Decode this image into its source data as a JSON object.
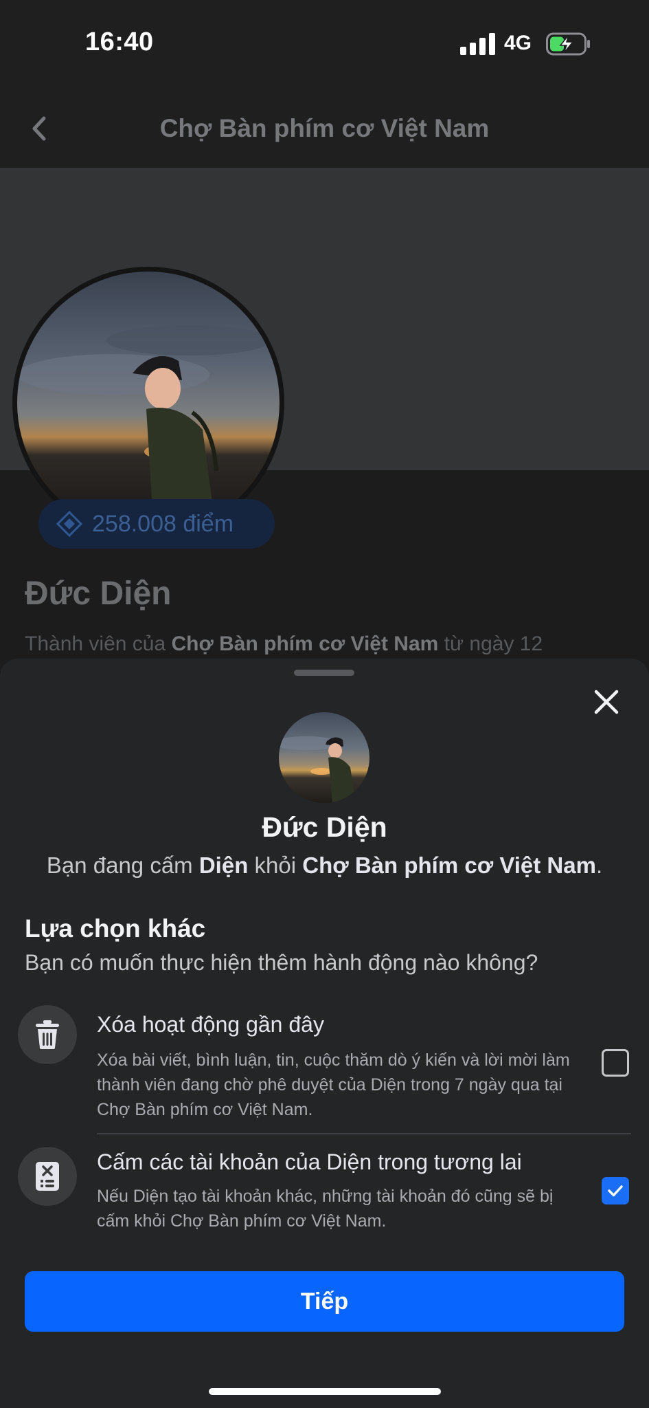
{
  "status_bar": {
    "time": "16:40",
    "network": "4G"
  },
  "header": {
    "title": "Chợ Bàn phím cơ Việt Nam"
  },
  "profile": {
    "points": "258.008 điểm",
    "name": "Đức Diện",
    "member_prefix": "Thành viên của ",
    "member_group": "Chợ Bàn phím cơ Việt Nam",
    "member_suffix": " từ ngày 12"
  },
  "sheet": {
    "name": "Đức Diện",
    "ban_prefix": "Bạn đang cấm ",
    "ban_user": "Diện",
    "ban_middle": " khỏi ",
    "ban_group": "Chợ Bàn phím cơ Việt Nam",
    "ban_end": ".",
    "options_heading": "Lựa chọn khác",
    "options_question": "Bạn có muốn thực hiện thêm hành động nào không?",
    "options": [
      {
        "icon": "trash-icon",
        "title": "Xóa hoạt động gần đây",
        "description": "Xóa bài viết, bình luận, tin, cuộc thăm dò ý kiến và lời mời làm thành viên đang chờ phê duyệt của Diện trong 7 ngày qua tại Chợ Bàn phím cơ Việt Nam.",
        "checked": false
      },
      {
        "icon": "ban-account-icon",
        "title": "Cấm các tài khoản của Diện trong tương lai",
        "description": "Nếu Diện tạo tài khoản khác, những tài khoản đó cũng sẽ bị cấm khỏi Chợ Bàn phím cơ Việt Nam.",
        "checked": true
      }
    ],
    "next_label": "Tiếp"
  },
  "colors": {
    "accent": "#0866ff",
    "checkbox_on": "#1a6ef5",
    "sheet_bg": "#242527"
  }
}
